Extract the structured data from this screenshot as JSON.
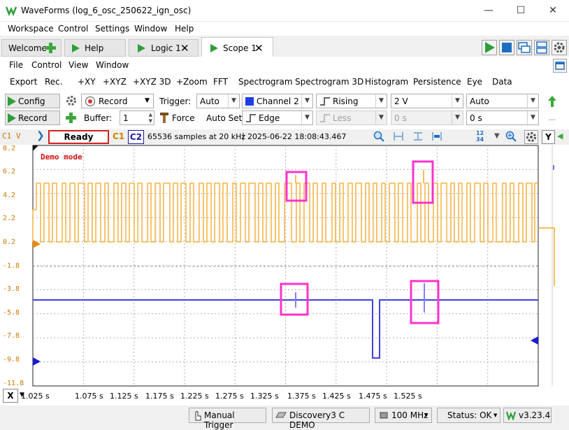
{
  "window": {
    "title": "WaveForms (log_6_osc_250622_ign_osc)"
  },
  "menu": [
    "Workspace",
    "Control",
    "Settings",
    "Window",
    "Help"
  ],
  "tabs": [
    {
      "label": "Welcome"
    },
    {
      "label": "Help"
    },
    {
      "label": "Logic 1"
    },
    {
      "label": "Scope 1"
    }
  ],
  "scope_menu": [
    "File",
    "Control",
    "View",
    "Window"
  ],
  "toolbar": [
    "Export",
    "Rec.",
    "+XY",
    "+XYZ",
    "+XYZ 3D",
    "+Zoom",
    "FFT",
    "Spectrogram",
    "Spectrogram 3D",
    "Histogram",
    "Persistence",
    "Eye",
    "Data"
  ],
  "controls": {
    "config_label": "Config",
    "record_mode": "Record",
    "record_label": "Record",
    "trigger_label": "Trigger:",
    "trigger_mode": "Auto",
    "trigger_source": "Channel 2",
    "trigger_condition": "Rising",
    "trigger_level": "2 V",
    "auto_label": "Auto",
    "buffer_label": "Buffer:",
    "buffer_value": "1",
    "force_label": "Force",
    "autoset_label": "Auto Set",
    "trigger_type": "Edge",
    "less_label": "Less",
    "hyst_value": "0 s",
    "holdoff_value": "0 s"
  },
  "status": {
    "axis_label": "C1 V",
    "state": "Ready",
    "ch1": "C1",
    "ch2": "C2",
    "info": "65536 samples at 20 kHz",
    "timestamp": "2025-06-22 18:08:43.467",
    "y_button": "Y"
  },
  "plot": {
    "demo_text": "Demo mode",
    "y_ticks": [
      "8.2",
      "6.2",
      "4.2",
      "2.2",
      "0.2",
      "-1.8",
      "-3.8",
      "-5.8",
      "-7.8",
      "-9.8",
      "-11.8"
    ],
    "x_ticks": [
      "1.025 s",
      "1.075 s",
      "1.125 s",
      "1.175 s",
      "1.225 s",
      "1.275 s",
      "1.325 s",
      "1.375 s",
      "1.425 s",
      "1.475 s",
      "1.525 s"
    ],
    "x_axis_button": "X",
    "colors": {
      "ch1": "#f5a623",
      "ch2": "#4040e0",
      "highlight": "#ff33cc"
    }
  },
  "bottom": {
    "manual_trigger": "Manual Trigger",
    "device": "Discovery3 C DEMO",
    "clock": "100 MHz",
    "status": "Status: OK",
    "version": "v3.23.4"
  }
}
